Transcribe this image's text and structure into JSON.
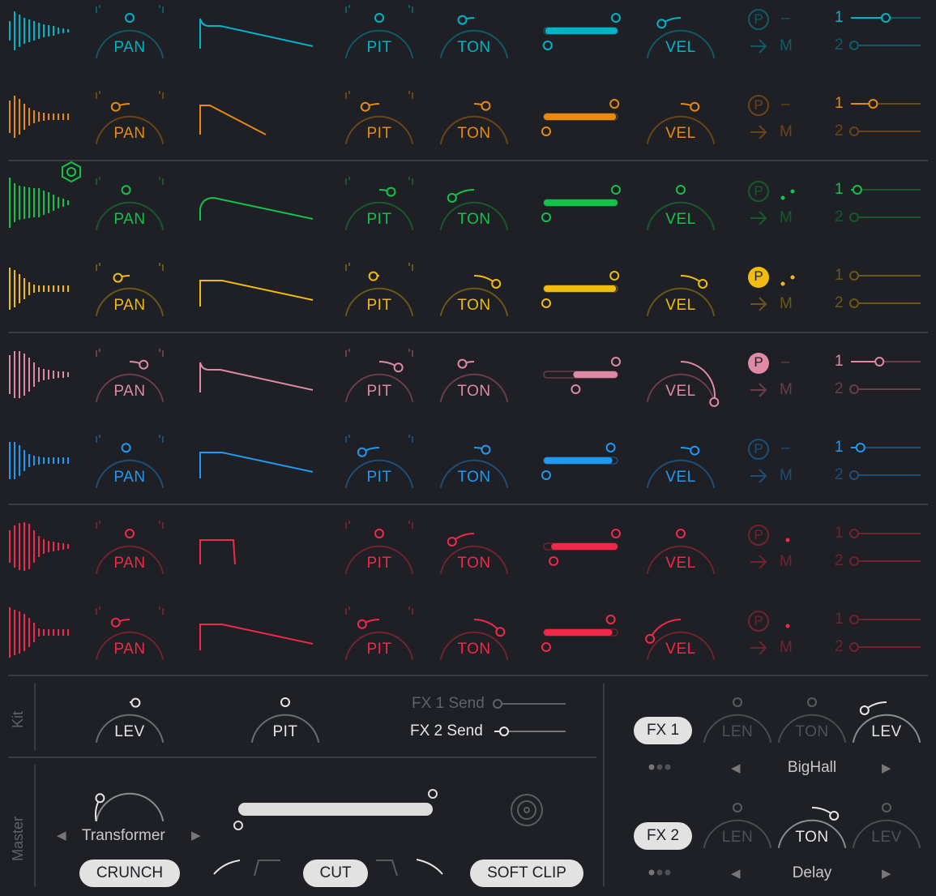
{
  "tracks": [
    {
      "color": "#00b4c8",
      "dim": "#0f5a66",
      "pan": 0.5,
      "pit": 0.5,
      "ton": 0.4,
      "vel": 0.33,
      "range": [
        0.02,
        1.0
      ],
      "p_filled": false,
      "p_dim": true,
      "mode": "dash",
      "send1": 0.5,
      "send2": 0.0,
      "send1_active": true,
      "send2_active": false,
      "env": "spike",
      "selected": false,
      "knob_labels": {
        "pan": "PAN",
        "pit": "PIT",
        "ton": "TON",
        "vel": "VEL"
      }
    },
    {
      "color": "#e88a10",
      "dim": "#6a4417",
      "pan": 0.38,
      "pit": 0.38,
      "ton": 0.6,
      "vel": 0.62,
      "range": [
        0.0,
        0.98
      ],
      "p_filled": false,
      "p_dim": true,
      "mode": "dash",
      "send1": 0.3,
      "send2": 0.0,
      "send1_active": true,
      "send2_active": false,
      "env": "short",
      "selected": false,
      "knob_labels": {
        "pan": "PAN",
        "pit": "PIT",
        "ton": "TON",
        "vel": "VEL"
      }
    },
    {
      "color": "#14c24a",
      "dim": "#17592d",
      "pan": 0.47,
      "pit": 0.6,
      "ton": 0.3,
      "vel": 0.5,
      "range": [
        0.0,
        1.0
      ],
      "p_filled": false,
      "p_dim": true,
      "mode": "dots",
      "send1": 0.05,
      "send2": 0.0,
      "send1_active": true,
      "send2_active": false,
      "env": "round",
      "selected": true,
      "knob_labels": {
        "pan": "PAN",
        "pit": "PIT",
        "ton": "TON",
        "vel": "VEL"
      }
    },
    {
      "color": "#f0bc10",
      "dim": "#6a5617",
      "pan": 0.4,
      "pit": 0.45,
      "ton": 0.7,
      "vel": 0.7,
      "range": [
        0.0,
        0.98
      ],
      "p_filled": true,
      "p_dim": false,
      "mode": "dots",
      "send1": 0.0,
      "send2": 0.0,
      "send1_active": false,
      "send2_active": false,
      "env": "flat",
      "selected": false,
      "knob_labels": {
        "pan": "PAN",
        "pit": "PIT",
        "ton": "TON",
        "vel": "VEL"
      }
    },
    {
      "color": "#e089a6",
      "dim": "#6a3c4c",
      "pan": 0.62,
      "pit": 0.67,
      "ton": 0.4,
      "vel": 1.0,
      "range": [
        0.4,
        1.0
      ],
      "p_filled": true,
      "p_dim": false,
      "mode": "dash",
      "send1": 0.4,
      "send2": 0.0,
      "send1_active": true,
      "send2_active": false,
      "env": "spike",
      "selected": false,
      "knob_labels": {
        "pan": "PAN",
        "pit": "PIT",
        "ton": "TON",
        "vel": "VEL"
      }
    },
    {
      "color": "#2099f0",
      "dim": "#1d4e78",
      "pan": 0.47,
      "pit": 0.35,
      "ton": 0.6,
      "vel": 0.62,
      "range": [
        0.0,
        0.93
      ],
      "p_filled": false,
      "p_dim": true,
      "mode": "dash",
      "send1": 0.1,
      "send2": 0.0,
      "send1_active": true,
      "send2_active": false,
      "env": "flat",
      "selected": false,
      "knob_labels": {
        "pan": "PAN",
        "pit": "PIT",
        "ton": "TON",
        "vel": "VEL"
      }
    },
    {
      "color": "#f0284a",
      "dim": "#70232f",
      "pan": 0.5,
      "pit": 0.5,
      "ton": 0.3,
      "vel": 0.5,
      "range": [
        0.1,
        1.0
      ],
      "p_filled": false,
      "p_dim": true,
      "mode": "dot",
      "send1": 0.0,
      "send2": 0.0,
      "send1_active": false,
      "send2_active": false,
      "env": "gate",
      "selected": false,
      "knob_labels": {
        "pan": "PAN",
        "pit": "PIT",
        "ton": "TON",
        "vel": "VEL"
      }
    },
    {
      "color": "#f0284a",
      "dim": "#70232f",
      "pan": 0.38,
      "pit": 0.35,
      "ton": 0.75,
      "vel": 0.18,
      "range": [
        0.0,
        0.93
      ],
      "p_filled": false,
      "p_dim": true,
      "mode": "dot",
      "send1": 0.0,
      "send2": 0.0,
      "send1_active": false,
      "send2_active": false,
      "env": "flat",
      "selected": false,
      "knob_labels": {
        "pan": "PAN",
        "pit": "PIT",
        "ton": "TON",
        "vel": "VEL"
      }
    }
  ],
  "track_misc": {
    "p_letter": "P",
    "mode_dash": "–",
    "route_label": "M",
    "send1_num": "1",
    "send2_num": "2"
  },
  "kit": {
    "label": "Kit",
    "lev_label": "LEV",
    "lev": 0.55,
    "pit_label": "PIT",
    "pit": 0.5,
    "fx1_send_label": "FX 1 Send",
    "fx1_send": 0.0,
    "fx2_send_label": "FX 2 Send",
    "fx2_send": 0.1
  },
  "master": {
    "label": "Master",
    "drive": 0.2,
    "preset": "Transformer",
    "buttons": {
      "crunch": "CRUNCH",
      "cut": "CUT",
      "soft_clip": "SOFT CLIP"
    },
    "range": [
      0.0,
      1.0
    ]
  },
  "fx": [
    {
      "button": "FX 1",
      "preset": "BigHall",
      "knobs": [
        {
          "label": "LEN",
          "value": 0.5,
          "active": false
        },
        {
          "label": "TON",
          "value": 0.5,
          "active": false
        },
        {
          "label": "LEV",
          "value": 0.3,
          "active": true
        }
      ]
    },
    {
      "button": "FX 2",
      "preset": "Delay",
      "knobs": [
        {
          "label": "LEN",
          "value": 0.5,
          "active": false
        },
        {
          "label": "TON",
          "value": 0.7,
          "active": true
        },
        {
          "label": "LEV",
          "value": 0.5,
          "active": false
        }
      ]
    }
  ]
}
